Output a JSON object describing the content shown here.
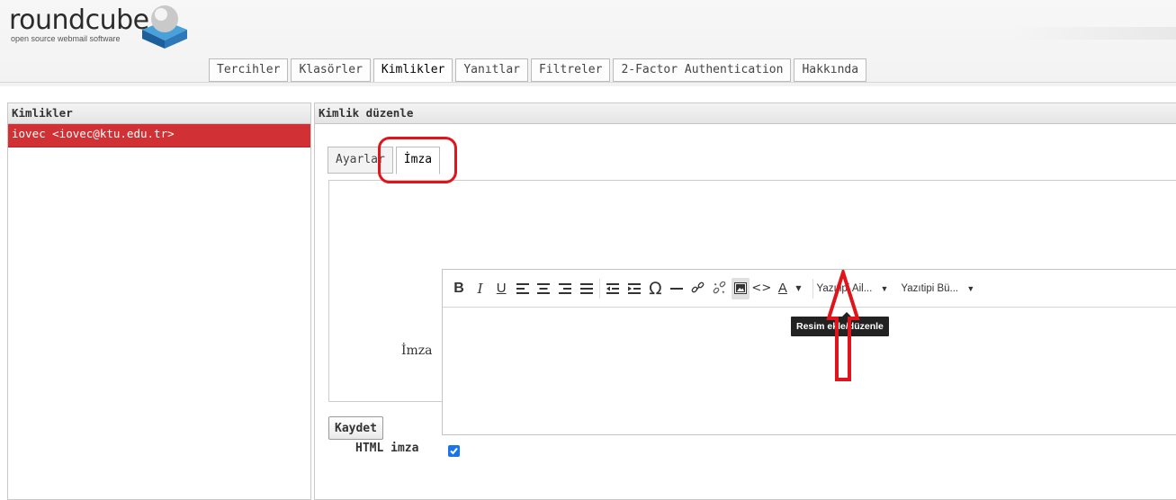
{
  "app": {
    "logo_text": "roundcube",
    "tagline": "open source webmail software"
  },
  "tabs": [
    {
      "label": "Tercihler",
      "active": false
    },
    {
      "label": "Klasörler",
      "active": false
    },
    {
      "label": "Kimlikler",
      "active": true
    },
    {
      "label": "Yanıtlar",
      "active": false
    },
    {
      "label": "Filtreler",
      "active": false
    },
    {
      "label": "2-Factor Authentication",
      "active": false
    },
    {
      "label": "Hakkında",
      "active": false
    }
  ],
  "left_panel": {
    "title": "Kimlikler",
    "identities": [
      {
        "label": "iovec <iovec@ktu.edu.tr>",
        "selected": true
      }
    ]
  },
  "right_panel": {
    "title": "Kimlik düzenle",
    "subtabs": [
      {
        "label": "Ayarlar",
        "active": false
      },
      {
        "label": "İmza",
        "active": true
      }
    ],
    "signature_label": "İmza",
    "html_signature_label": "HTML imza",
    "html_signature_checked": true,
    "save_label": "Kaydet"
  },
  "toolbar": {
    "icons": [
      "bold-icon",
      "italic-icon",
      "underline-icon",
      "align-left-icon",
      "align-center-icon",
      "align-right-icon",
      "align-justify-icon",
      "outdent-icon",
      "indent-icon",
      "special-char-icon",
      "horizontal-rule-icon",
      "link-icon",
      "unlink-icon",
      "image-icon",
      "source-code-icon",
      "text-color-icon"
    ],
    "font_family_label": "Yazıtipi Ail...",
    "font_size_label": "Yazıtipi Bü...",
    "tooltip": "Resim ekle/düzenle"
  },
  "colors": {
    "selected_row": "#d13134",
    "annotation": "#e0141a",
    "checkbox": "#1a73e8"
  }
}
